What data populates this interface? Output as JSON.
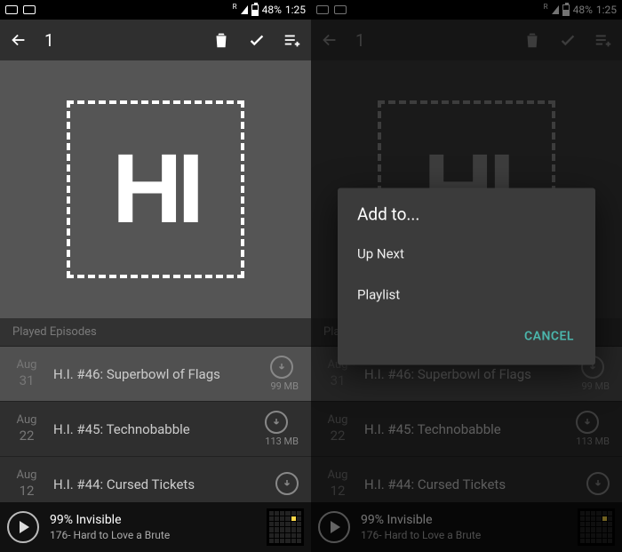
{
  "status": {
    "battery_pct": "48%",
    "time": "1:25",
    "net_indicator": "R"
  },
  "actionbar": {
    "selection_count": "1"
  },
  "hero": {
    "logo_text": "HI"
  },
  "section": {
    "played_header": "Played Episodes"
  },
  "episodes": [
    {
      "month": "Aug",
      "day": "31",
      "title": "H.I. #46: Superbowl of Flags",
      "size": "99 MB"
    },
    {
      "month": "Aug",
      "day": "22",
      "title": "H.I. #45: Technobabble",
      "size": "113 MB"
    },
    {
      "month": "Aug",
      "day": "12",
      "title": "H.I. #44: Cursed Tickets",
      "size": ""
    }
  ],
  "nowplaying": {
    "show": "99% Invisible",
    "episode": "176- Hard to Love a Brute"
  },
  "dialog": {
    "title": "Add to...",
    "option_up_next": "Up Next",
    "option_playlist": "Playlist",
    "cancel": "CANCEL"
  }
}
